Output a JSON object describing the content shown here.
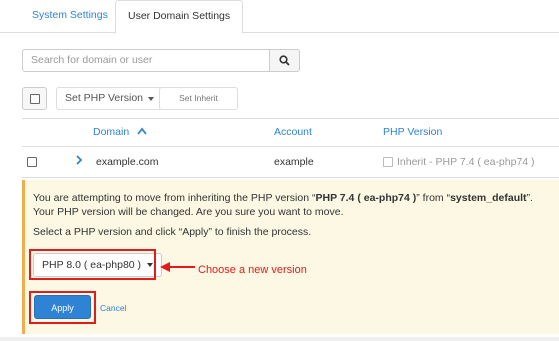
{
  "tabs": [
    {
      "label": "System Settings",
      "active": false
    },
    {
      "label": "User Domain Settings",
      "active": true
    }
  ],
  "search": {
    "placeholder": "Search for domain or user",
    "value": ""
  },
  "toolbar": {
    "set_php_label": "Set PHP Version",
    "set_inherit_label": "Set Inherit"
  },
  "table": {
    "columns": [
      {
        "label": "Domain",
        "sort": "ascending"
      },
      {
        "label": "Account"
      },
      {
        "label": "PHP Version"
      }
    ],
    "rows": [
      {
        "domain": "example.com",
        "account": "example",
        "php_version": "Inherit - PHP 7.4 ( ea-php74 )"
      }
    ]
  },
  "alert": {
    "message_prefix": "You are attempting to move from inheriting the PHP version “",
    "message_version": "PHP 7.4 ( ea-php74 )",
    "message_mid": "” from “",
    "message_source": "system_default",
    "message_suffix": "”. Your PHP version will be changed. Are you sure you want to move.",
    "instruction": "Select a PHP version and click “Apply” to finish the process.",
    "selected_version": "PHP 8.0 ( ea-php80 )",
    "apply_label": "Apply",
    "cancel_label": "Cancel"
  },
  "annotation": {
    "text": "Choose a new version",
    "color": "#e21b1b"
  },
  "colors": {
    "accent": "#2f83d5",
    "alert_bg": "#fcf8e3",
    "alert_border": "#f0ad4e"
  }
}
